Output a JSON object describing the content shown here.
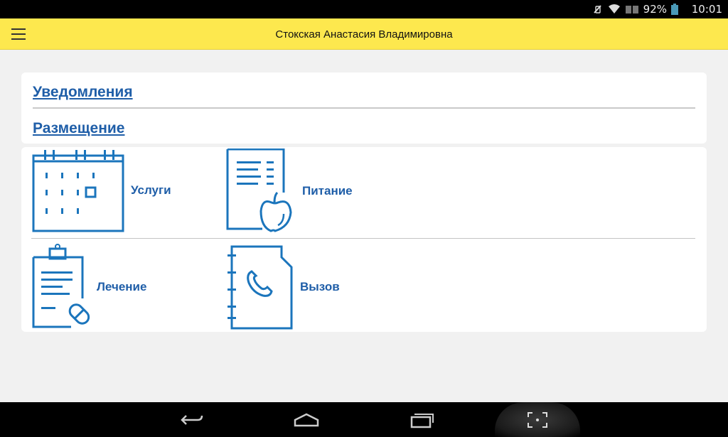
{
  "status_bar": {
    "battery_percent": "92%",
    "time": "10:01",
    "icons": [
      "vibrate-icon",
      "wifi-icon",
      "sim-icon",
      "battery-icon"
    ]
  },
  "toolbar": {
    "title": "Стокская Анастасия Владимировна",
    "menu_icon": "hamburger-menu-icon"
  },
  "links": {
    "notifications": "Уведомления",
    "placement": "Размещение"
  },
  "tiles": [
    {
      "label": "Услуги",
      "icon": "calendar-icon"
    },
    {
      "label": "Питание",
      "icon": "menu-apple-icon"
    },
    {
      "label": "Лечение",
      "icon": "clipboard-pill-icon"
    },
    {
      "label": "Вызов",
      "icon": "phonebook-icon"
    }
  ],
  "nav_bar": {
    "buttons": [
      "back-icon",
      "home-icon",
      "recents-icon",
      "screenshot-icon"
    ]
  },
  "colors": {
    "accent_yellow": "#fde84e",
    "link_blue": "#1f5ea8",
    "icon_blue": "#1b75bc"
  }
}
